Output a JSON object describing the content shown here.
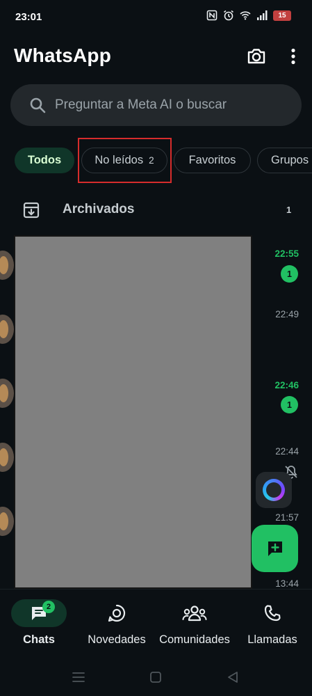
{
  "status_bar": {
    "time": "23:01",
    "battery": "15",
    "icons": [
      "nfc-icon",
      "alarm-icon",
      "wifi-icon",
      "signal-icon",
      "battery-icon"
    ]
  },
  "header": {
    "title": "WhatsApp",
    "icons": [
      "camera-icon",
      "more-vert-icon"
    ]
  },
  "search": {
    "placeholder": "Preguntar a Meta AI o buscar"
  },
  "filters": [
    {
      "label": "Todos",
      "count": "",
      "active": true
    },
    {
      "label": "No leídos",
      "count": "2",
      "active": false
    },
    {
      "label": "Favoritos",
      "count": "",
      "active": false
    },
    {
      "label": "Grupos",
      "count": "",
      "active": false
    }
  ],
  "archived": {
    "label": "Archivados",
    "count": "1"
  },
  "chats": [
    {
      "time": "22:55",
      "unread": "1"
    },
    {
      "time": "22:49",
      "unread": ""
    },
    {
      "time": "22:46",
      "unread": "1"
    },
    {
      "time": "22:44",
      "unread": "",
      "muted": true
    },
    {
      "time": "21:57",
      "unread": ""
    },
    {
      "time": "13:44",
      "unread": ""
    }
  ],
  "bottom_nav": [
    {
      "label": "Chats",
      "icon": "chats-icon",
      "active": true,
      "badge": "2"
    },
    {
      "label": "Novedades",
      "icon": "updates-icon",
      "active": false,
      "badge": ""
    },
    {
      "label": "Comunidades",
      "icon": "communities-icon",
      "active": false,
      "badge": ""
    },
    {
      "label": "Llamadas",
      "icon": "phone-icon",
      "active": false,
      "badge": ""
    }
  ],
  "colors": {
    "background": "#0b1014",
    "accent": "#21c063",
    "active_chip": "#103629",
    "highlight_box": "#d62c2c",
    "redaction": "#808080"
  }
}
